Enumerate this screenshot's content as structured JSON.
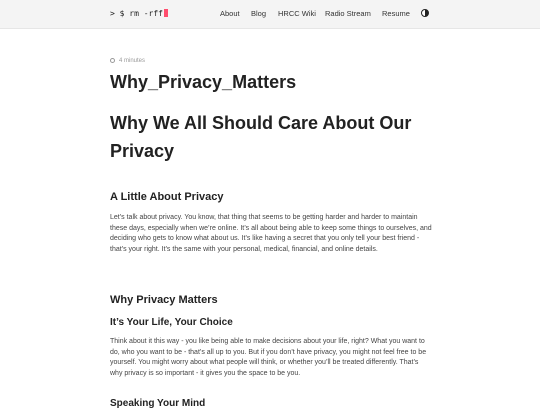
{
  "header": {
    "logo_text": "> $ rm -rff",
    "nav": [
      "About",
      "Blog",
      "HRCC Wiki",
      "Radio Stream",
      "Resume"
    ]
  },
  "post": {
    "read_time": "4 minutes",
    "title": "Why_Privacy_Matters",
    "h1": "Why We All Should Care About Our Privacy",
    "sections": [
      {
        "heading": "A Little About Privacy",
        "body": "Let’s talk about privacy. You know, that thing that seems to be getting harder and harder to maintain these days, especially when we’re online. It’s all about being able to keep some things to ourselves, and deciding who gets to know what about us. It’s like having a secret that you only tell your best friend - that’s your right. It’s the same with your personal, medical, financial, and online details."
      },
      {
        "heading": "Why Privacy Matters",
        "subheading": "It’s Your Life, Your Choice",
        "body": "Think about it this way - you like being able to make decisions about your life, right? What you want to do, who you want to be - that’s all up to you. But if you don’t have privacy, you might not feel free to be yourself. You might worry about what people will think, or whether you’ll be treated differently. That’s why privacy is so important - it gives you the space to be you."
      },
      {
        "subheading": "Speaking Your Mind"
      }
    ]
  },
  "colors": {
    "cursor": "#ff4d6d",
    "header_bg": "#f4f4f4"
  }
}
